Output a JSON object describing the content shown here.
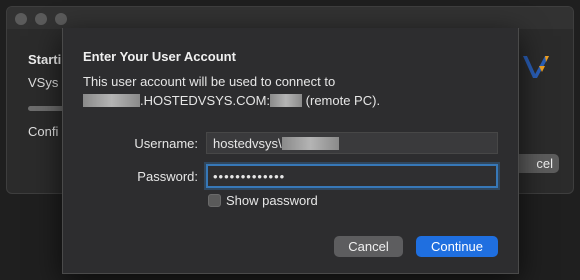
{
  "background_window": {
    "heading": "Starti",
    "subtext": "VSys",
    "status": "Confi",
    "cancel_label": "cel",
    "progress": 0.1
  },
  "dialog": {
    "title": "Enter Your User Account",
    "description_line1": "This user account will be used to connect to",
    "description_host": ".HOSTEDVSYS.COM:",
    "description_suffix": "(remote PC).",
    "username_label": "Username:",
    "username_value": "hostedvsys\\",
    "password_label": "Password:",
    "password_value": "•••••••••••••",
    "show_password_label": "Show password",
    "show_password_checked": false,
    "cancel_label": "Cancel",
    "continue_label": "Continue"
  },
  "colors": {
    "accent": "#1f6fe0",
    "focus_ring": "#3778b8",
    "logo_blue": "#2a5fb8",
    "logo_orange": "#f0a020"
  }
}
